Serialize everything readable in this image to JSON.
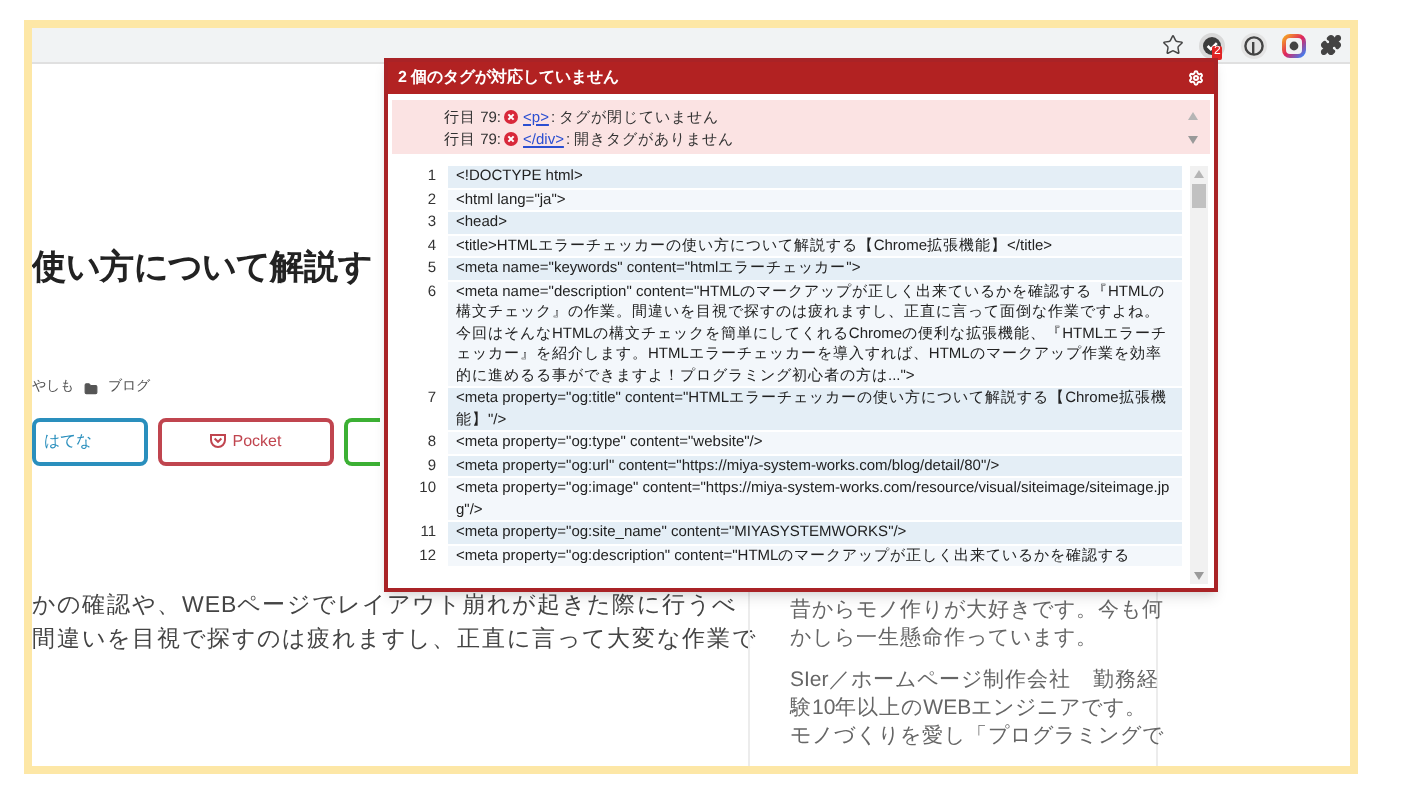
{
  "toolbar": {
    "extension_badge": "2"
  },
  "article": {
    "title": "使い方について解説す",
    "author": "やしも",
    "category": "ブログ",
    "share_buttons": [
      {
        "label": "はてな",
        "color": "#2a8fbd",
        "kind": "text"
      },
      {
        "label": "Pocket",
        "color": "#c0454f",
        "kind": "pocket"
      },
      {
        "color": "#3cb034",
        "kind": "blank"
      }
    ],
    "body_lines": [
      "かの確認や、WEBページでレイアウト崩れが起きた際に行うべ",
      "間違いを目視で探すのは疲れますし、正直に言って大変な作業で"
    ]
  },
  "sidebar": {
    "paragraphs": [
      [
        "昔からモノ作りが大好きです。今も何",
        "かしら一生懸命作っています。"
      ],
      [
        "SIer／ホームページ制作会社　勤務経",
        "験10年以上のWEBエンジニアです。",
        "モノづくりを愛し「プログラミングで"
      ]
    ]
  },
  "checker": {
    "title": "2 個のタグが対応していません",
    "errors": [
      {
        "line": "行目 79:",
        "tag": "<p>",
        "message": ": タグが閉じていません"
      },
      {
        "line": "行目 79:",
        "tag": "</div>",
        "message": ": 開きタグがありません"
      }
    ],
    "code_lines": [
      {
        "number": "1",
        "text": "<!DOCTYPE html>"
      },
      {
        "number": "2",
        "text": "<html lang=\"ja\">"
      },
      {
        "number": "3",
        "text": "<head>"
      },
      {
        "number": "4",
        "text": "<title>HTMLエラーチェッカーの使い方について解説する【Chrome拡張機能】</title>"
      },
      {
        "number": "5",
        "text": "<meta name=\"keywords\" content=\"htmlエラーチェッカー\">"
      },
      {
        "number": "6",
        "text": "<meta name=\"description\" content=\"HTMLのマークアップが正しく出来ているかを確認する『HTMLの構文チェック』の作業。間違いを目視で探すのは疲れますし、正直に言って面倒な作業ですよね。今回はそんなHTMLの構文チェックを簡単にしてくれるChromeの便利な拡張機能、『HTMLエラーチェッカー』を紹介します。HTMLエラーチェッカーを導入すれば、HTMLのマークアップ作業を効率的に進めるる事ができますよ！プログラミング初心者の方は...\">"
      },
      {
        "number": "7",
        "text": "<meta property=\"og:title\" content=\"HTMLエラーチェッカーの使い方について解説する【Chrome拡張機能】\"/>"
      },
      {
        "number": "8",
        "text": "<meta property=\"og:type\" content=\"website\"/>"
      },
      {
        "number": "9",
        "text": "<meta property=\"og:url\" content=\"https://miya-system-works.com/blog/detail/80\"/>"
      },
      {
        "number": "10",
        "text": "<meta property=\"og:image\" content=\"https://miya-system-works.com/resource/visual/siteimage/siteimage.jpg\"/>"
      },
      {
        "number": "11",
        "text": "<meta property=\"og:site_name\" content=\"MIYASYSTEMWORKS\"/>"
      },
      {
        "number": "12",
        "text": "<meta property=\"og:description\" content=\"HTMLのマークアップが正しく出来ているかを確認する"
      }
    ]
  }
}
